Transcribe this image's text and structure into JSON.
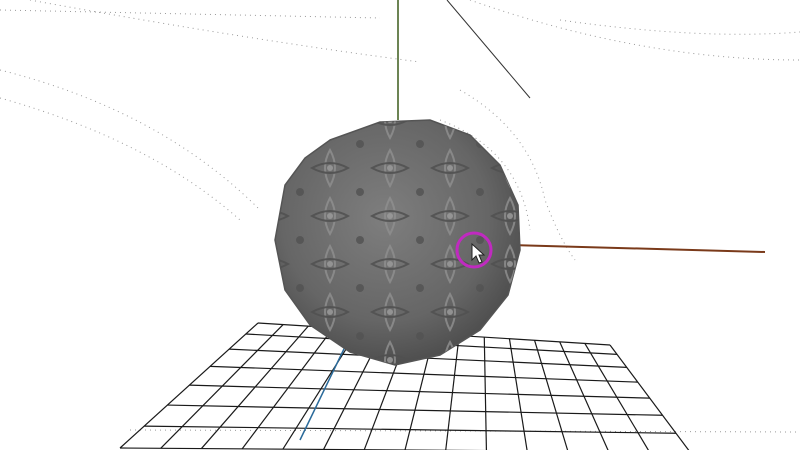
{
  "viewport": {
    "background_color": "#ffffff",
    "grid_color": "#1a1a1a",
    "sphere_color": "#6b6b6b",
    "sphere_pattern_light": "#8c8c8c",
    "sphere_pattern_dark": "#4a4a4a",
    "x_axis_color": "#7a3a1a",
    "y_axis_color": "#3a5a1a",
    "z_axis_color": "#2a6a9a",
    "cursor_ring_color": "#c02ac0",
    "cursor_icon": "arrow-cursor-icon"
  }
}
